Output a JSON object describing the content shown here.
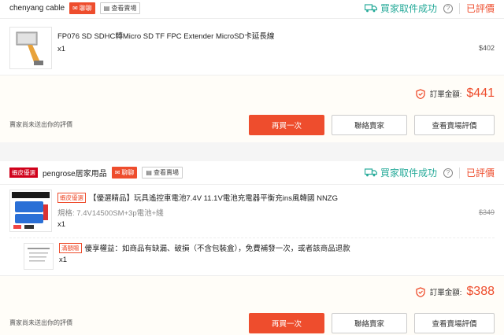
{
  "colors": {
    "accent": "#ee4d2d",
    "status_green": "#26aa99",
    "page_bg": "#f5f5f5"
  },
  "orders": [
    {
      "shop": {
        "name": "chenyang cable",
        "mall_badge": "",
        "chat_label": "聊聊",
        "shop_label": "查看賣場"
      },
      "status": {
        "text": "買家取件成功",
        "rated": "已評價",
        "icon": "truck-icon"
      },
      "items": [
        {
          "name": "FP076 SD SDHC轉Micro SD TF FPC Extender MicroSD卡延長線",
          "variation": "",
          "qty": "x1",
          "price_old": "",
          "price": "$402",
          "badge": ""
        }
      ],
      "total": {
        "label": "訂單金額:",
        "value": "$441"
      },
      "note": "賣家尚未送出你的評價",
      "actions": {
        "primary": "再買一次",
        "secondary1": "聯絡賣家",
        "secondary2": "查看賣場評價"
      }
    },
    {
      "shop": {
        "name": "pengrose居家用品",
        "mall_badge": "蝦皮優選",
        "chat_label": "聊聊",
        "shop_label": "查看賣場"
      },
      "status": {
        "text": "買家取件成功",
        "rated": "已評價",
        "icon": "truck-icon"
      },
      "items": [
        {
          "name": "【優選精品】玩具遙控車電池7.4V 11.1V電池充電器平衡充ins風韓國 NNZG",
          "variation": "規格: 7.4V14500SM+3p電池+綫",
          "qty": "x1",
          "price_old": "$349",
          "price": "",
          "badge": "蝦皮優選"
        },
        {
          "name": "優享權益：如商品有缺漏、破損（不含包裝盒），免費補發一次，或者該商品退款",
          "variation": "",
          "qty": "x1",
          "price_old": "",
          "price": "",
          "badge": "滿額贈"
        }
      ],
      "total": {
        "label": "訂單金額:",
        "value": "$388"
      },
      "note": "賣家尚未送出你的評價",
      "actions": {
        "primary": "再買一次",
        "secondary1": "聯絡賣家",
        "secondary2": "查看賣場評價"
      }
    }
  ]
}
